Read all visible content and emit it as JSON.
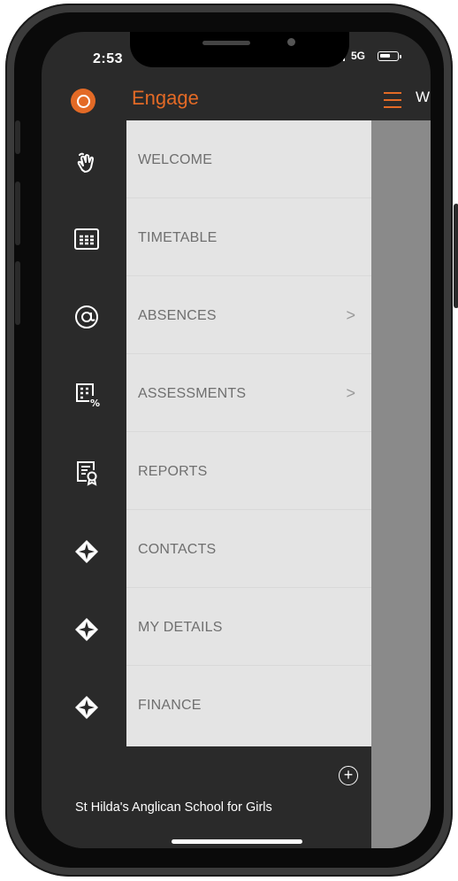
{
  "status": {
    "time": "2:53",
    "network": "5G"
  },
  "appbar": {
    "brand": "Engage",
    "peek_text": "W"
  },
  "colors": {
    "accent": "#e36a26",
    "rail": "#2a2a2a",
    "drawer": "#e4e4e4"
  },
  "menu": {
    "items": [
      {
        "label": "WELCOME",
        "icon": "waving-hand-icon",
        "has_chevron": false
      },
      {
        "label": "TIMETABLE",
        "icon": "timetable-icon",
        "has_chevron": false
      },
      {
        "label": "ABSENCES",
        "icon": "at-sign-icon",
        "has_chevron": true
      },
      {
        "label": "ASSESSMENTS",
        "icon": "grid-percent-icon",
        "has_chevron": true
      },
      {
        "label": "REPORTS",
        "icon": "certificate-icon",
        "has_chevron": false
      },
      {
        "label": "CONTACTS",
        "icon": "diamond-icon",
        "has_chevron": false
      },
      {
        "label": "MY DETAILS",
        "icon": "diamond-icon",
        "has_chevron": false
      },
      {
        "label": "FINANCE",
        "icon": "diamond-icon",
        "has_chevron": false
      }
    ],
    "chevron": ">"
  },
  "footer": {
    "school": "St Hilda's Anglican School for Girls",
    "add": "+"
  }
}
